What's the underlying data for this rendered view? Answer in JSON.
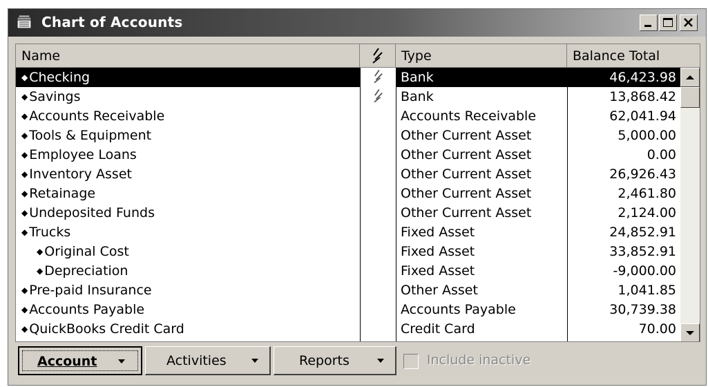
{
  "window": {
    "title": "Chart of Accounts",
    "icon": "chart-of-accounts-icon"
  },
  "columns": {
    "name": "Name",
    "check_icon": "bank-reconcile-check-icon",
    "type": "Type",
    "balance": "Balance Total"
  },
  "rows": [
    {
      "name": "Checking",
      "indent": 0,
      "checked": true,
      "type": "Bank",
      "balance": "46,423.98",
      "selected": true
    },
    {
      "name": "Savings",
      "indent": 0,
      "checked": true,
      "type": "Bank",
      "balance": "13,868.42"
    },
    {
      "name": "Accounts Receivable",
      "indent": 0,
      "checked": false,
      "type": "Accounts Receivable",
      "balance": "62,041.94"
    },
    {
      "name": "Tools & Equipment",
      "indent": 0,
      "checked": false,
      "type": "Other Current Asset",
      "balance": "5,000.00"
    },
    {
      "name": "Employee Loans",
      "indent": 0,
      "checked": false,
      "type": "Other Current Asset",
      "balance": "0.00"
    },
    {
      "name": "Inventory Asset",
      "indent": 0,
      "checked": false,
      "type": "Other Current Asset",
      "balance": "26,926.43"
    },
    {
      "name": "Retainage",
      "indent": 0,
      "checked": false,
      "type": "Other Current Asset",
      "balance": "2,461.80"
    },
    {
      "name": "Undeposited Funds",
      "indent": 0,
      "checked": false,
      "type": "Other Current Asset",
      "balance": "2,124.00"
    },
    {
      "name": "Trucks",
      "indent": 0,
      "checked": false,
      "type": "Fixed Asset",
      "balance": "24,852.91"
    },
    {
      "name": "Original Cost",
      "indent": 1,
      "checked": false,
      "type": "Fixed Asset",
      "balance": "33,852.91"
    },
    {
      "name": "Depreciation",
      "indent": 1,
      "checked": false,
      "type": "Fixed Asset",
      "balance": "-9,000.00"
    },
    {
      "name": "Pre-paid Insurance",
      "indent": 0,
      "checked": false,
      "type": "Other Asset",
      "balance": "1,041.85"
    },
    {
      "name": "Accounts Payable",
      "indent": 0,
      "checked": false,
      "type": "Accounts Payable",
      "balance": "30,739.38"
    },
    {
      "name": "QuickBooks Credit Card",
      "indent": 0,
      "checked": false,
      "type": "Credit Card",
      "balance": "70.00"
    }
  ],
  "toolbar": {
    "account": "Account",
    "activities": "Activities",
    "reports": "Reports",
    "include_inactive": "Include inactive",
    "include_inactive_checked": false
  },
  "colors": {
    "selection": "#000000",
    "face": "#d4d0c8",
    "title_start": "#2a2a2a",
    "title_end": "#c2c2c2"
  }
}
